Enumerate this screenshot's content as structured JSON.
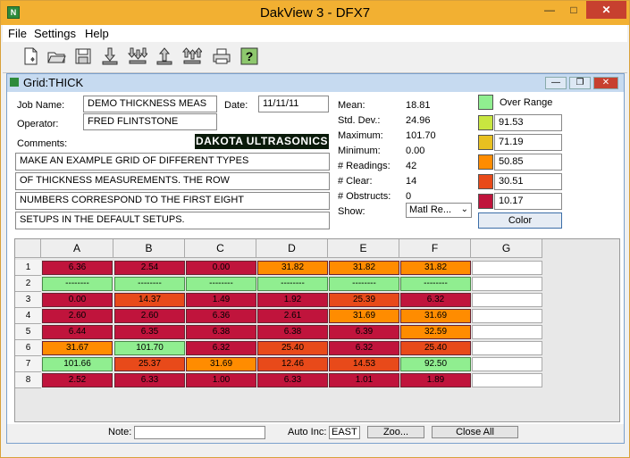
{
  "window": {
    "title": "DakView 3 - DFX7",
    "icon": "app-icon",
    "min_glyph": "—",
    "max_glyph": "□",
    "close_glyph": "✕"
  },
  "menu": [
    "File",
    "Settings",
    "Help"
  ],
  "toolbar": [
    "new-file-icon",
    "open-folder-icon",
    "save-disk-icon",
    "download-icon",
    "download-multi-icon",
    "upload-icon",
    "upload-multi-icon",
    "print-icon",
    "help-icon"
  ],
  "grid_window": {
    "title": "Grid:THICK",
    "min_glyph": "—",
    "restore_glyph": "❐",
    "close_glyph": "✕",
    "job_label": "Job Name:",
    "job_name": "DEMO THICKNESS MEAS",
    "date_label": "Date:",
    "date": "11/11/11",
    "operator_label": "Operator:",
    "operator": "FRED FLINTSTONE",
    "comments_label": "Comments:",
    "comments": [
      "MAKE AN EXAMPLE GRID OF DIFFERENT TYPES",
      "OF THICKNESS MEASUREMENTS.  THE ROW",
      "NUMBERS CORRESPOND TO THE FIRST EIGHT",
      "SETUPS IN THE DEFAULT SETUPS."
    ],
    "logo": "DAKOTA ULTRASONICS",
    "stats": [
      {
        "label": "Mean:",
        "value": "18.81"
      },
      {
        "label": "Std. Dev.:",
        "value": "24.96"
      },
      {
        "label": "Maximum:",
        "value": "101.70"
      },
      {
        "label": "Minimum:",
        "value": "0.00"
      },
      {
        "label": "# Readings:",
        "value": "42"
      },
      {
        "label": "# Clear:",
        "value": "14"
      },
      {
        "label": "# Obstructs:",
        "value": "0"
      }
    ],
    "show_label": "Show:",
    "show_value": "Matl Re...",
    "show_arrow": "⌄",
    "legend": [
      {
        "color": "#90ee90",
        "label": "Over Range"
      },
      {
        "color": "#c8e640",
        "label": "91.53"
      },
      {
        "color": "#e8c020",
        "label": "71.19"
      },
      {
        "color": "#ff8c00",
        "label": "50.85"
      },
      {
        "color": "#e84a1a",
        "label": "30.51"
      },
      {
        "color": "#c0143c",
        "label": "10.17"
      }
    ],
    "color_button": "Color",
    "columns": [
      "A",
      "B",
      "C",
      "D",
      "E",
      "F",
      "G"
    ],
    "rows": [
      {
        "num": "1",
        "cells": [
          {
            "v": "6.36",
            "c": "#c0143c"
          },
          {
            "v": "2.54",
            "c": "#c0143c"
          },
          {
            "v": "0.00",
            "c": "#c0143c"
          },
          {
            "v": "31.82",
            "c": "#ff8c00"
          },
          {
            "v": "31.82",
            "c": "#ff8c00"
          },
          {
            "v": "31.82",
            "c": "#ff8c00"
          },
          {
            "v": "",
            "c": "#ffffff"
          }
        ]
      },
      {
        "num": "2",
        "cells": [
          {
            "v": "--------",
            "c": "#90ee90"
          },
          {
            "v": "--------",
            "c": "#90ee90"
          },
          {
            "v": "--------",
            "c": "#90ee90"
          },
          {
            "v": "--------",
            "c": "#90ee90"
          },
          {
            "v": "--------",
            "c": "#90ee90"
          },
          {
            "v": "--------",
            "c": "#90ee90"
          },
          {
            "v": "",
            "c": "#ffffff"
          }
        ]
      },
      {
        "num": "3",
        "cells": [
          {
            "v": "0.00",
            "c": "#c0143c"
          },
          {
            "v": "14.37",
            "c": "#e84a1a"
          },
          {
            "v": "1.49",
            "c": "#c0143c"
          },
          {
            "v": "1.92",
            "c": "#c0143c"
          },
          {
            "v": "25.39",
            "c": "#e84a1a"
          },
          {
            "v": "6.32",
            "c": "#c0143c"
          },
          {
            "v": "",
            "c": "#ffffff"
          }
        ]
      },
      {
        "num": "4",
        "cells": [
          {
            "v": "2.60",
            "c": "#c0143c"
          },
          {
            "v": "2.60",
            "c": "#c0143c"
          },
          {
            "v": "6.36",
            "c": "#c0143c"
          },
          {
            "v": "2.61",
            "c": "#c0143c"
          },
          {
            "v": "31.69",
            "c": "#ff8c00"
          },
          {
            "v": "31.69",
            "c": "#ff8c00"
          },
          {
            "v": "",
            "c": "#ffffff"
          }
        ]
      },
      {
        "num": "5",
        "cells": [
          {
            "v": "6.44",
            "c": "#c0143c"
          },
          {
            "v": "6.35",
            "c": "#c0143c"
          },
          {
            "v": "6.38",
            "c": "#c0143c"
          },
          {
            "v": "6.38",
            "c": "#c0143c"
          },
          {
            "v": "6.39",
            "c": "#c0143c"
          },
          {
            "v": "32.59",
            "c": "#ff8c00"
          },
          {
            "v": "",
            "c": "#ffffff"
          }
        ]
      },
      {
        "num": "6",
        "cells": [
          {
            "v": "31.67",
            "c": "#ff8c00"
          },
          {
            "v": "101.70",
            "c": "#90ee90"
          },
          {
            "v": "6.32",
            "c": "#c0143c"
          },
          {
            "v": "25.40",
            "c": "#e84a1a"
          },
          {
            "v": "6.32",
            "c": "#c0143c"
          },
          {
            "v": "25.40",
            "c": "#e84a1a"
          },
          {
            "v": "",
            "c": "#ffffff"
          }
        ]
      },
      {
        "num": "7",
        "cells": [
          {
            "v": "101.66",
            "c": "#90ee90"
          },
          {
            "v": "25.37",
            "c": "#e84a1a"
          },
          {
            "v": "31.69",
            "c": "#ff8c00"
          },
          {
            "v": "12.46",
            "c": "#e84a1a"
          },
          {
            "v": "14.53",
            "c": "#e84a1a"
          },
          {
            "v": "92.50",
            "c": "#90ee90"
          },
          {
            "v": "",
            "c": "#ffffff"
          }
        ]
      },
      {
        "num": "8",
        "cells": [
          {
            "v": "2.52",
            "c": "#c0143c"
          },
          {
            "v": "6.33",
            "c": "#c0143c"
          },
          {
            "v": "1.00",
            "c": "#c0143c"
          },
          {
            "v": "6.33",
            "c": "#c0143c"
          },
          {
            "v": "1.01",
            "c": "#c0143c"
          },
          {
            "v": "1.89",
            "c": "#c0143c"
          },
          {
            "v": "",
            "c": "#ffffff"
          }
        ]
      }
    ],
    "note_label": "Note:",
    "note_value": "",
    "auto_inc_label": "Auto Inc:",
    "auto_inc_value": "EAST",
    "zoom_button": "Zoo...",
    "close_all_button": "Close All"
  }
}
